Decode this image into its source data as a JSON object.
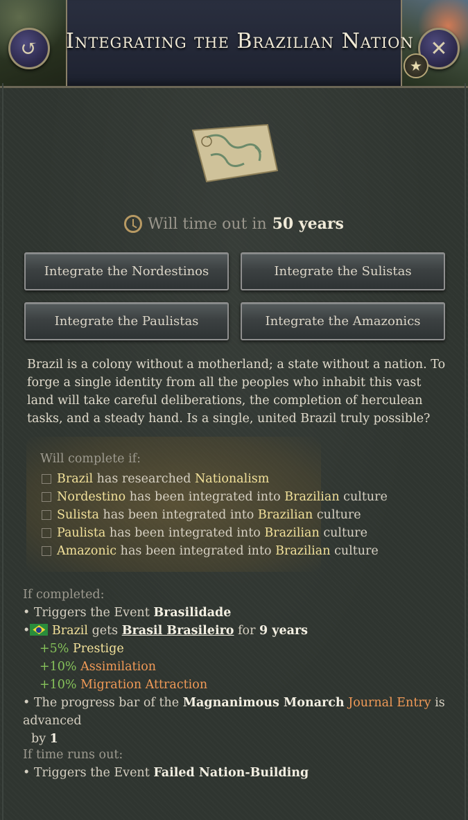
{
  "header": {
    "title": "Integrating the Brazilian Nation",
    "back_icon": "↺",
    "close_icon": "✕",
    "star_icon": "★"
  },
  "timeout": {
    "prefix": "Will time out in",
    "value": "50 years"
  },
  "options": [
    "Integrate the Nordestinos",
    "Integrate the Sulistas",
    "Integrate the Paulistas",
    "Integrate the Amazonics"
  ],
  "description": "Brazil is a colony without a motherland; a state without a nation. To forge a single identity from all the peoples who inhabit this vast land will take careful deliberations, the completion of herculean tasks, and a steady hand. Is a single, united Brazil truly possible?",
  "conditions": {
    "title": "Will complete if:",
    "items": [
      {
        "a": "Brazil",
        "b": "has researched",
        "c": "Nationalism",
        "d": ""
      },
      {
        "a": "Nordestino",
        "b": "has been integrated into",
        "c": "Brazilian",
        "d": "culture"
      },
      {
        "a": "Sulista",
        "b": "has been integrated into",
        "c": "Brazilian",
        "d": "culture"
      },
      {
        "a": "Paulista",
        "b": "has been integrated into",
        "c": "Brazilian",
        "d": "culture"
      },
      {
        "a": "Amazonic",
        "b": "has been integrated into",
        "c": "Brazilian",
        "d": "culture"
      }
    ]
  },
  "completed": {
    "title": "If completed:",
    "event_prefix": "• Triggers the Event",
    "event_name": "Brasilidade",
    "bullet": "•",
    "country": "Brazil",
    "gets": "gets",
    "modifier": "Brasil Brasileiro",
    "for_text": "for",
    "duration": "9 years",
    "effects": [
      {
        "value": "+5%",
        "label": "Prestige",
        "label_color": "#f2e19a"
      },
      {
        "value": "+10%",
        "label": "Assimilation",
        "label_color": "#f19a57"
      },
      {
        "value": "+10%",
        "label": "Migration Attraction",
        "label_color": "#f19a57"
      }
    ],
    "progress_prefix": "• The progress bar of the",
    "progress_name": "Magnanimous Monarch",
    "progress_link": "Journal Entry",
    "progress_suffix": "is advanced",
    "progress_by": "by",
    "progress_amount": "1"
  },
  "timeout_effects": {
    "title": "If time runs out:",
    "event_prefix": "• Triggers the Event",
    "event_name": "Failed Nation-Building"
  }
}
